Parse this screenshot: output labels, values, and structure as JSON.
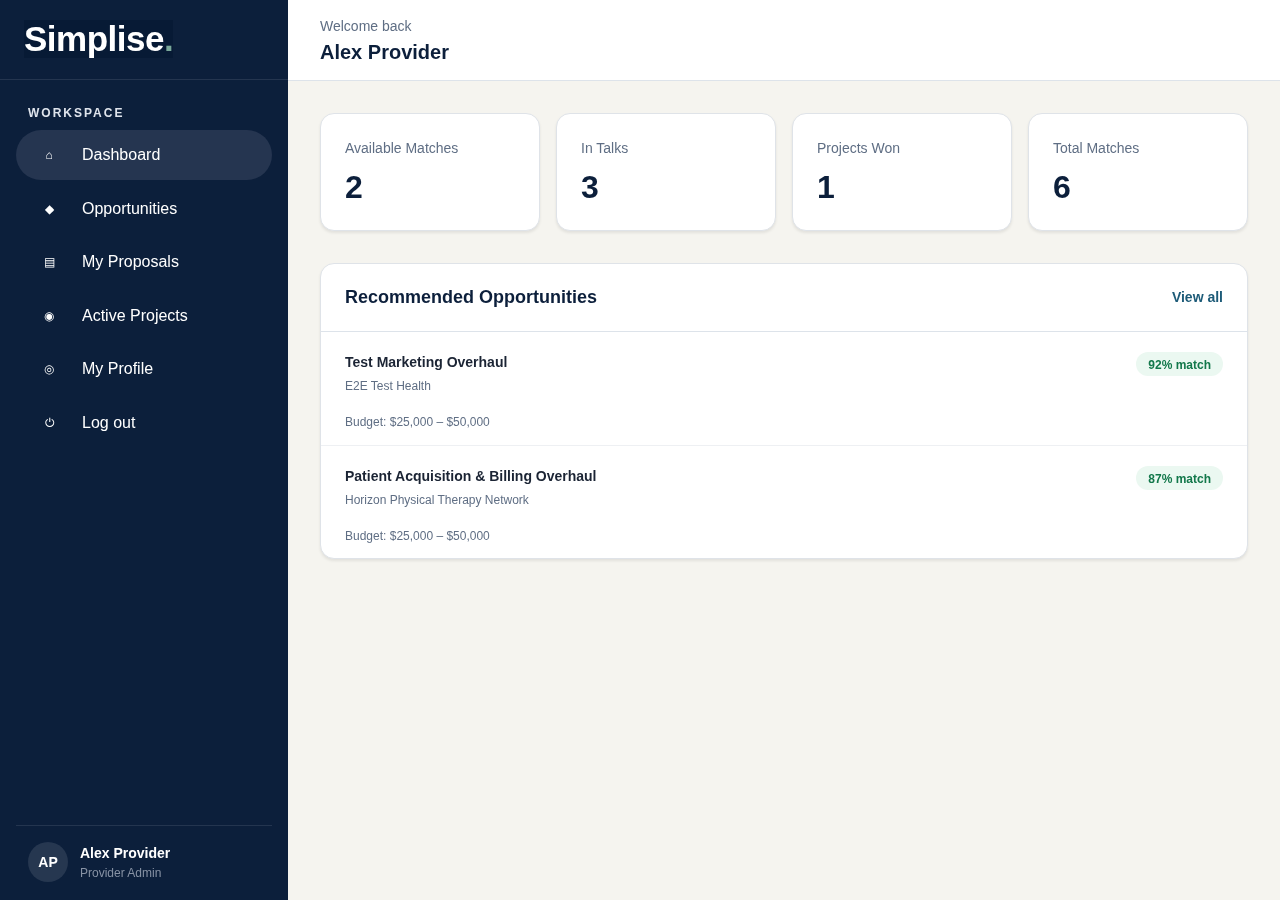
{
  "sidebar": {
    "logo": {
      "text": "Simplise",
      "mark": "."
    },
    "section_label": "WORKSPACE",
    "items": [
      {
        "icon": "⌂",
        "label": "Dashboard",
        "selected": true
      },
      {
        "icon": "◆",
        "label": "Opportunities",
        "selected": false
      },
      {
        "icon": "▤",
        "label": "My Proposals",
        "selected": false
      },
      {
        "icon": "◉",
        "label": "Active Projects",
        "selected": false
      },
      {
        "icon": "◎",
        "label": "My Profile",
        "selected": false
      },
      {
        "icon": "⏻",
        "label": "Log out",
        "selected": false
      }
    ],
    "user": {
      "initials": "AP",
      "name": "Alex Provider",
      "role": "Provider Admin"
    }
  },
  "header": {
    "greeting": "Welcome back",
    "name": "Alex Provider"
  },
  "stats": [
    {
      "label": "Available Matches",
      "value": "2"
    },
    {
      "label": "In Talks",
      "value": "3"
    },
    {
      "label": "Projects Won",
      "value": "1"
    },
    {
      "label": "Total Matches",
      "value": "6"
    }
  ],
  "recommended": {
    "title": "Recommended Opportunities",
    "link": "View all",
    "items": [
      {
        "title": "Test Marketing Overhaul",
        "client": "E2E Test Health",
        "budget": "Budget: $25,000 – $50,000",
        "match": "92% match"
      },
      {
        "title": "Patient Acquisition & Billing Overhaul",
        "client": "Horizon Physical Therapy Network",
        "budget": "Budget: $25,000 – $50,000",
        "match": "87% match"
      }
    ]
  }
}
